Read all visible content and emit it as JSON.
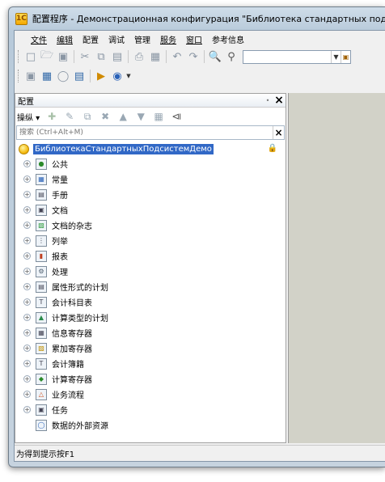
{
  "window": {
    "title": "配置程序 - Демонстрационная конфигурация \"Библиотека стандартных подсистем\""
  },
  "menubar": [
    {
      "label": "文件",
      "underline": true
    },
    {
      "label": "编辑",
      "underline": true
    },
    {
      "label": "配置",
      "underline": false
    },
    {
      "label": "调试",
      "underline": false
    },
    {
      "label": "管理",
      "underline": false
    },
    {
      "label": "服务",
      "underline": true
    },
    {
      "label": "窗口",
      "underline": true
    },
    {
      "label": "参考信息",
      "underline": false
    }
  ],
  "panel": {
    "title": "配置",
    "pin_icon": "pin-icon",
    "actions_label": "操纵",
    "filter_placeholder": "搜索 (Ctrl+Alt+M)"
  },
  "tree": {
    "root_label": "БиблиотекаСтандартныхПодсистемДемо",
    "items": [
      {
        "label": "公共",
        "icon": "common-icon",
        "expandable": true
      },
      {
        "label": "常量",
        "icon": "constants-icon",
        "expandable": true
      },
      {
        "label": "手册",
        "icon": "catalogs-icon",
        "expandable": true
      },
      {
        "label": "文档",
        "icon": "documents-icon",
        "expandable": true
      },
      {
        "label": "文档的杂志",
        "icon": "journals-icon",
        "expandable": true
      },
      {
        "label": "列举",
        "icon": "enums-icon",
        "expandable": true
      },
      {
        "label": "报表",
        "icon": "reports-icon",
        "expandable": true
      },
      {
        "label": "处理",
        "icon": "processing-icon",
        "expandable": true
      },
      {
        "label": "属性形式的计划",
        "icon": "chart-of-characteristics-icon",
        "expandable": true
      },
      {
        "label": "会计科目表",
        "icon": "chart-of-accounts-icon",
        "expandable": true
      },
      {
        "label": "计算类型的计划",
        "icon": "chart-of-calculation-icon",
        "expandable": true
      },
      {
        "label": "信息寄存器",
        "icon": "info-register-icon",
        "expandable": true
      },
      {
        "label": "累加寄存器",
        "icon": "accumulation-register-icon",
        "expandable": true
      },
      {
        "label": "会计簿籍",
        "icon": "accounting-register-icon",
        "expandable": true
      },
      {
        "label": "计算寄存器",
        "icon": "calculation-register-icon",
        "expandable": true
      },
      {
        "label": "业务流程",
        "icon": "business-process-icon",
        "expandable": true
      },
      {
        "label": "任务",
        "icon": "tasks-icon",
        "expandable": true
      },
      {
        "label": "数据的外部资源",
        "icon": "external-data-icon",
        "expandable": false
      }
    ]
  },
  "statusbar": {
    "text": "为得到提示按F1"
  }
}
